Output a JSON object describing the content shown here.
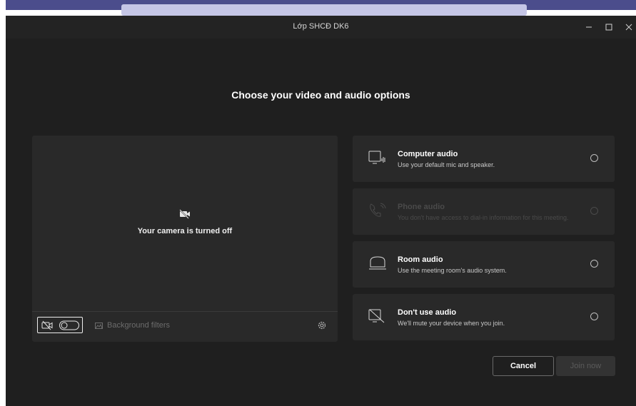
{
  "window": {
    "title": "Lớp SHCĐ DK6",
    "controls": {
      "minimize": "−",
      "maximize": "☐",
      "close": "✕"
    }
  },
  "heading": "Choose your video and audio options",
  "preview": {
    "camera_status": "Your camera is turned off",
    "background_filters_label": "Background filters"
  },
  "audio_options": [
    {
      "title": "Computer audio",
      "description": "Use your default mic and speaker.",
      "icon": "computer-audio-icon",
      "enabled": true
    },
    {
      "title": "Phone audio",
      "description": "You don't have access to dial-in information for this meeting.",
      "icon": "phone-audio-icon",
      "enabled": false
    },
    {
      "title": "Room audio",
      "description": "Use the meeting room's audio system.",
      "icon": "room-audio-icon",
      "enabled": true
    },
    {
      "title": "Don't use audio",
      "description": "We'll mute your device when you join.",
      "icon": "no-audio-icon",
      "enabled": true
    }
  ],
  "actions": {
    "cancel_label": "Cancel",
    "join_label": "Join now"
  },
  "colors": {
    "background": "#1f1f1f",
    "card": "#292929",
    "titlebar_accent": "#4b4d8c"
  }
}
